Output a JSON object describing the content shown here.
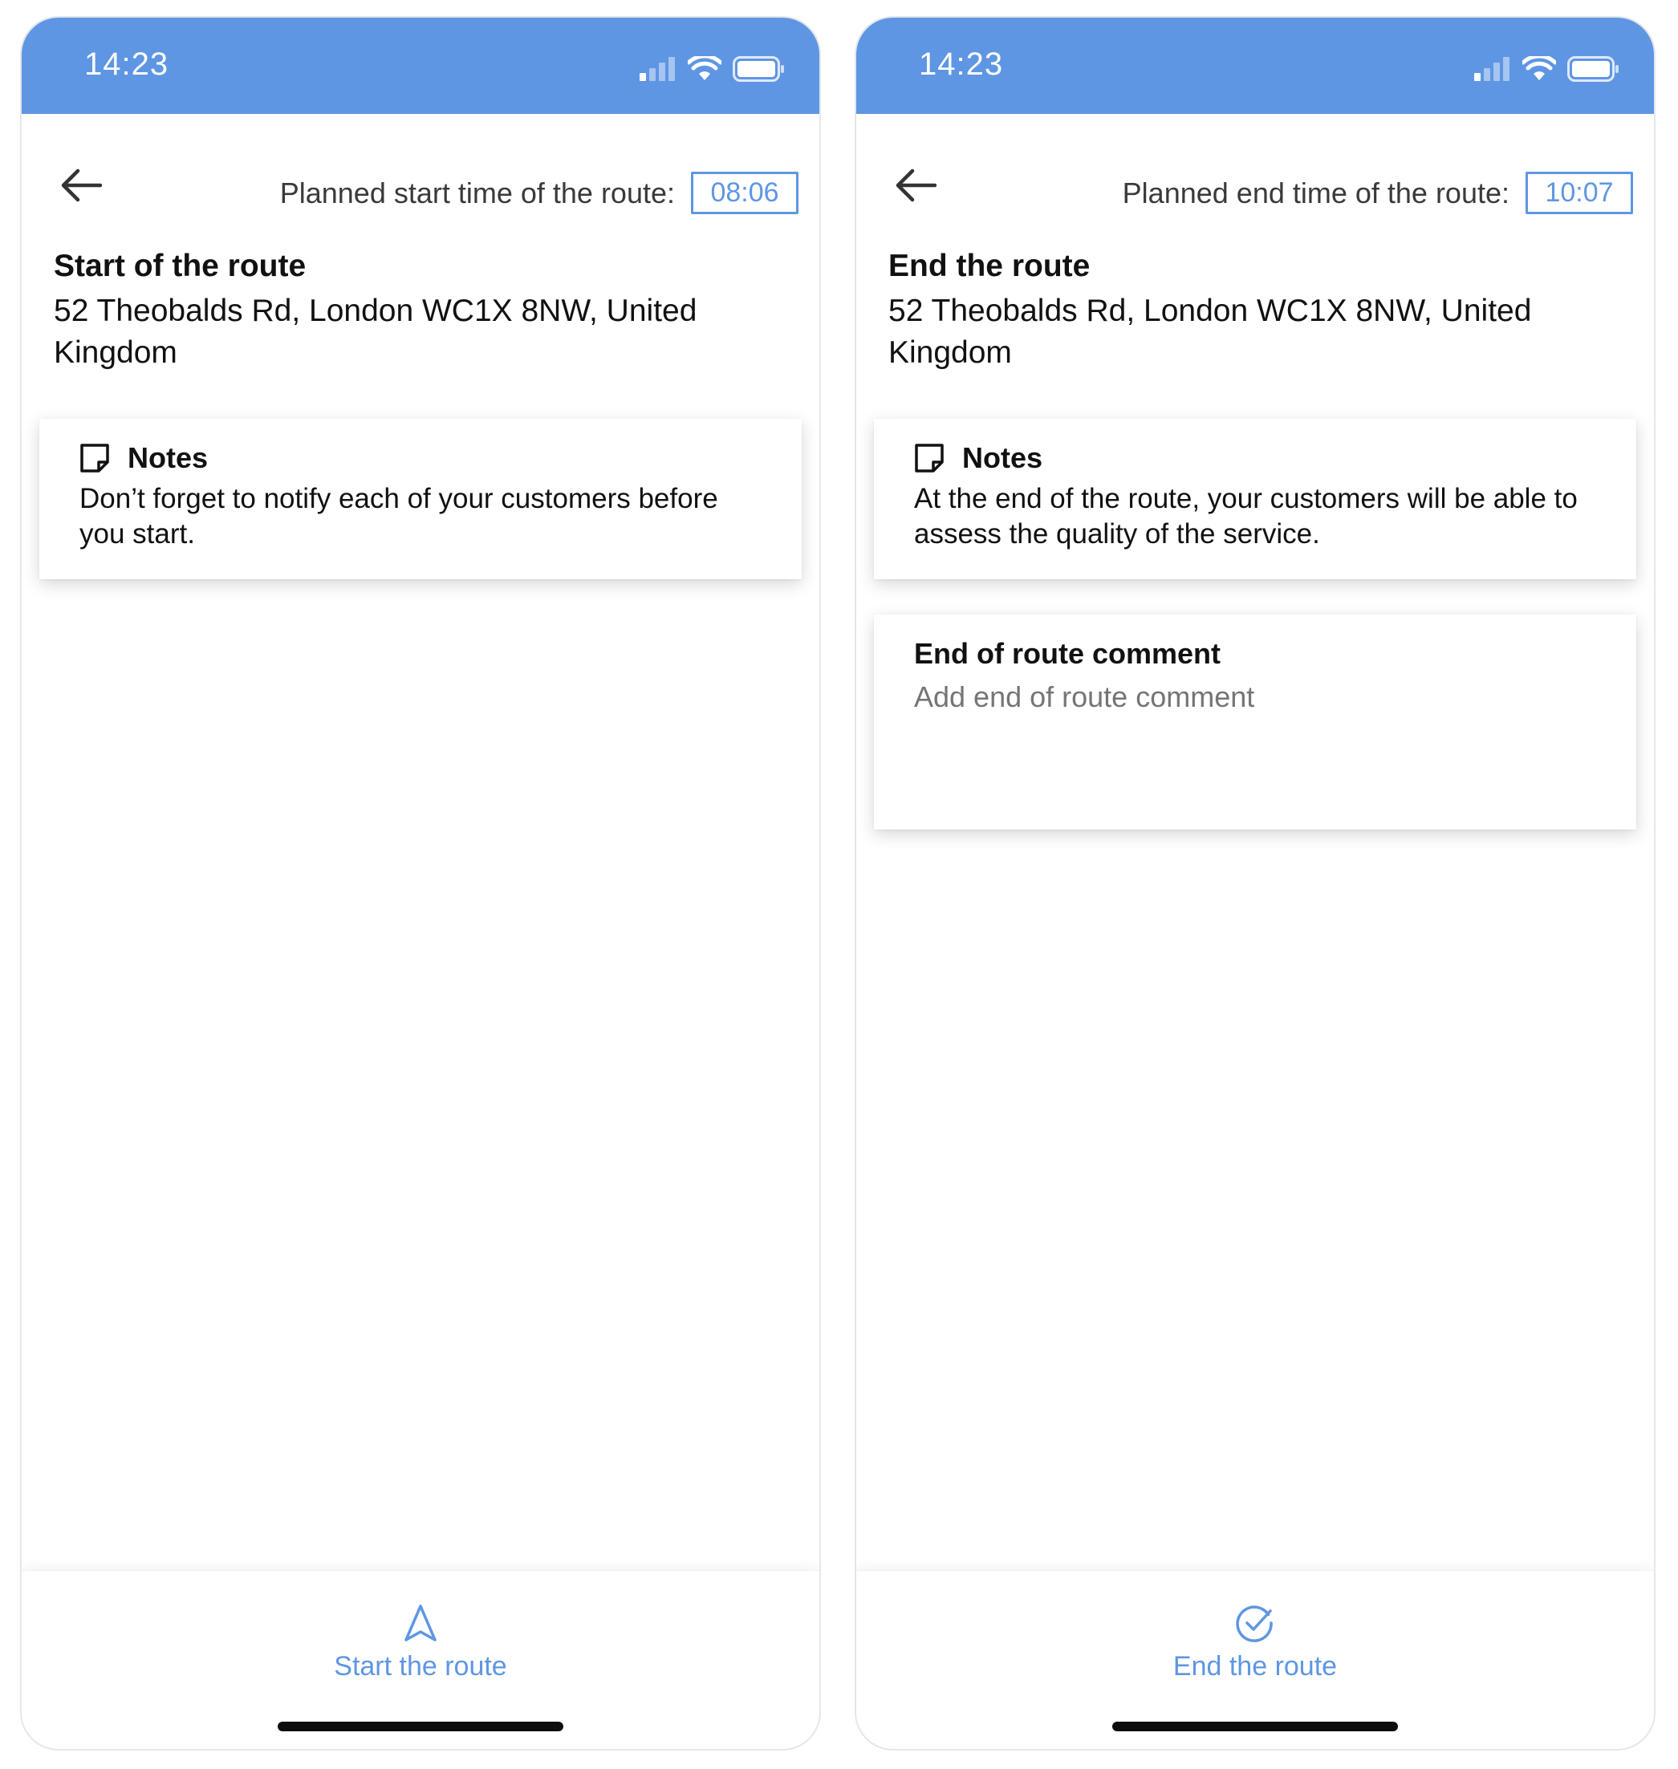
{
  "screens": [
    {
      "status_time": "14:23",
      "header": {
        "time_label": "Planned start time of the route:",
        "time_value": "08:06"
      },
      "route": {
        "title": "Start of the route",
        "address": "52 Theobalds Rd, London WC1X 8NW, United Kingdom"
      },
      "notes": {
        "title": "Notes",
        "text": "Don’t forget to notify each of your customers before you start."
      },
      "action": {
        "label": "Start the route",
        "icon": "navigation-arrow-icon"
      }
    },
    {
      "status_time": "14:23",
      "header": {
        "time_label": "Planned end time of the route:",
        "time_value": "10:07"
      },
      "route": {
        "title": "End the route",
        "address": "52 Theobalds Rd, London WC1X 8NW, United Kingdom"
      },
      "notes": {
        "title": "Notes",
        "text": "At the end of the route, your customers will be able to assess the quality of the service."
      },
      "comment": {
        "title": "End of route comment",
        "placeholder": "Add end of route comment",
        "value": ""
      },
      "action": {
        "label": "End the route",
        "icon": "check-circle-icon"
      }
    }
  ],
  "colors": {
    "accent": "#5e96e3",
    "text": "#111111",
    "muted": "#555555"
  }
}
